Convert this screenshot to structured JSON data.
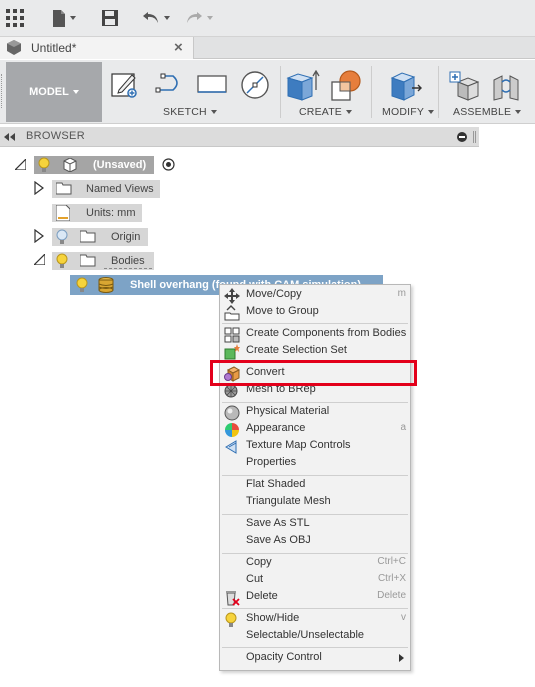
{
  "tab": {
    "title": "Untitled*"
  },
  "ribbon": {
    "workspace_label": "MODEL",
    "groups": [
      {
        "label": "SKETCH"
      },
      {
        "label": "CREATE"
      },
      {
        "label": "MODIFY"
      },
      {
        "label": "ASSEMBLE"
      }
    ]
  },
  "browser": {
    "title": "BROWSER",
    "root_label": "(Unsaved)",
    "items": [
      {
        "label": "Named Views"
      },
      {
        "label": "Units: mm"
      },
      {
        "label": "Origin"
      },
      {
        "label": "Bodies"
      }
    ],
    "selected_body": "Shell overhang (found with CAM simulation)"
  },
  "context_menu": {
    "groups": [
      [
        {
          "label": "Move/Copy",
          "shortcut": "m"
        },
        {
          "label": "Move to Group",
          "shortcut": ""
        }
      ],
      [
        {
          "label": "Create Components from Bodies",
          "shortcut": ""
        },
        {
          "label": "Create Selection Set",
          "shortcut": ""
        }
      ],
      [
        {
          "label": "Convert",
          "shortcut": ""
        },
        {
          "label": "Mesh to BRep",
          "shortcut": ""
        }
      ],
      [
        {
          "label": "Physical Material",
          "shortcut": ""
        },
        {
          "label": "Appearance",
          "shortcut": "a"
        },
        {
          "label": "Texture Map Controls",
          "shortcut": ""
        },
        {
          "label": "Properties",
          "shortcut": ""
        }
      ],
      [
        {
          "label": "Flat Shaded",
          "shortcut": ""
        },
        {
          "label": "Triangulate Mesh",
          "shortcut": ""
        }
      ],
      [
        {
          "label": "Save As STL",
          "shortcut": ""
        },
        {
          "label": "Save As OBJ",
          "shortcut": ""
        }
      ],
      [
        {
          "label": "Copy",
          "shortcut": "Ctrl+C"
        },
        {
          "label": "Cut",
          "shortcut": "Ctrl+X"
        },
        {
          "label": "Delete",
          "shortcut": "Delete"
        }
      ],
      [
        {
          "label": "Show/Hide",
          "shortcut": "v"
        },
        {
          "label": "Selectable/Unselectable",
          "shortcut": ""
        }
      ],
      [
        {
          "label": "Opacity Control",
          "shortcut": ""
        }
      ]
    ]
  },
  "colors": {
    "highlight": "#e3001b",
    "selection": "#7da3c6",
    "accent": "#2f6fb3"
  }
}
